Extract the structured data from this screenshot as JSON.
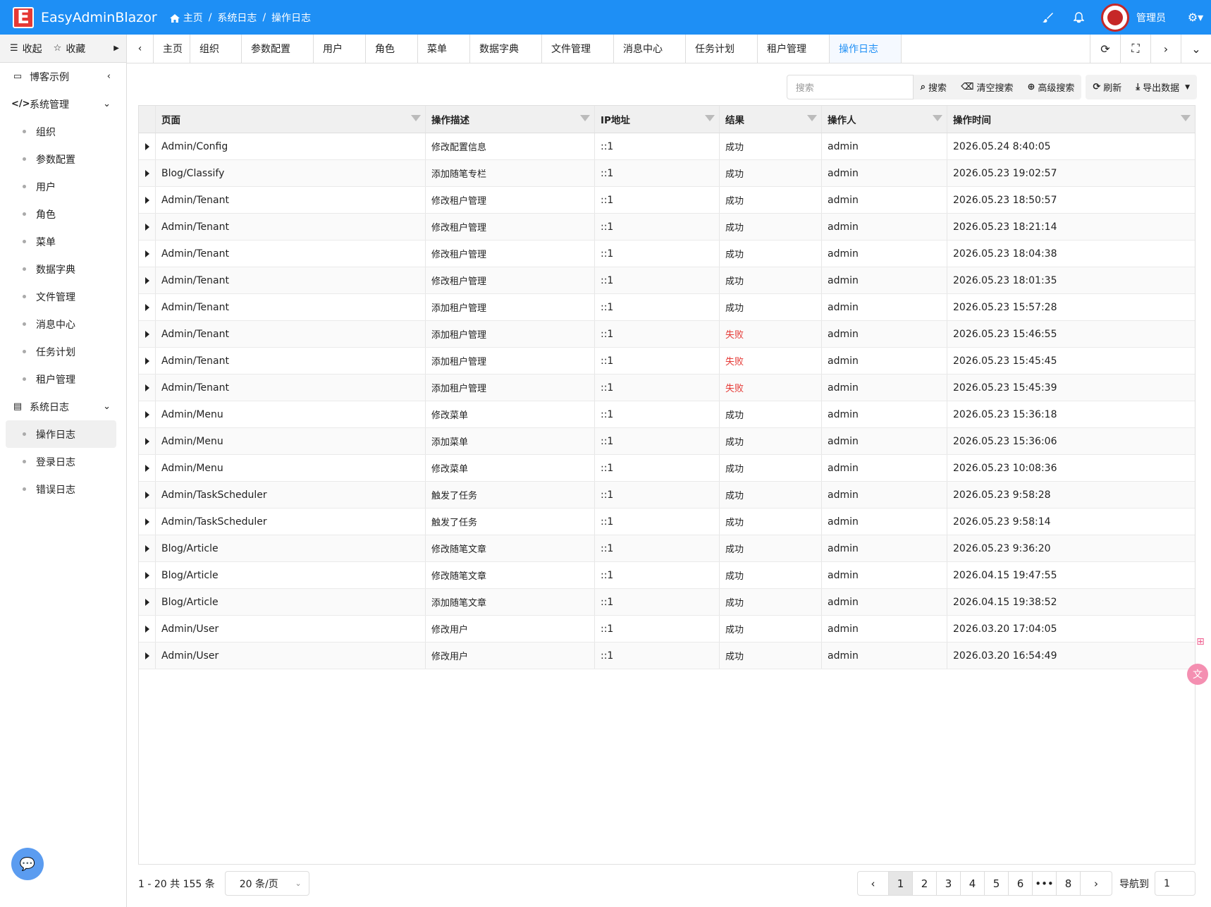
{
  "header": {
    "app_title": "EasyAdminBlazor",
    "breadcrumb": [
      "主页",
      "系统日志",
      "操作日志"
    ],
    "user_name": "管理员",
    "icons": [
      "brush-icon",
      "bell-icon",
      "gear-icon"
    ]
  },
  "sidebar": {
    "collapse_label": "收起",
    "favorites_label": "收藏",
    "groups": [
      {
        "label": "博客示例",
        "icon": "laptop-icon",
        "expanded": false,
        "items": []
      },
      {
        "label": "系统管理",
        "icon": "code-icon",
        "expanded": true,
        "items": [
          "组织",
          "参数配置",
          "用户",
          "角色",
          "菜单",
          "数据字典",
          "文件管理",
          "消息中心",
          "任务计划",
          "租户管理"
        ]
      },
      {
        "label": "系统日志",
        "icon": "server-icon",
        "expanded": true,
        "items": [
          "操作日志",
          "登录日志",
          "错误日志"
        ]
      }
    ],
    "active_item": "操作日志"
  },
  "tabs": [
    "主页",
    "组织",
    "参数配置",
    "用户",
    "角色",
    "菜单",
    "数据字典",
    "文件管理",
    "消息中心",
    "任务计划",
    "租户管理",
    "操作日志"
  ],
  "active_tab": "操作日志",
  "toolbar": {
    "search_placeholder": "搜索",
    "search_label": "搜索",
    "clear_label": "清空搜索",
    "advanced_label": "高级搜索",
    "refresh_label": "刷新",
    "export_label": "导出数据"
  },
  "table": {
    "columns": [
      "页面",
      "操作描述",
      "IP地址",
      "结果",
      "操作人",
      "操作时间"
    ],
    "rows": [
      [
        "Admin/Config",
        "修改配置信息",
        "::1",
        "成功",
        "admin",
        "2026.05.24 8:40:05"
      ],
      [
        "Blog/Classify",
        "添加随笔专栏",
        "::1",
        "成功",
        "admin",
        "2026.05.23 19:02:57"
      ],
      [
        "Admin/Tenant",
        "修改租户管理",
        "::1",
        "成功",
        "admin",
        "2026.05.23 18:50:57"
      ],
      [
        "Admin/Tenant",
        "修改租户管理",
        "::1",
        "成功",
        "admin",
        "2026.05.23 18:21:14"
      ],
      [
        "Admin/Tenant",
        "修改租户管理",
        "::1",
        "成功",
        "admin",
        "2026.05.23 18:04:38"
      ],
      [
        "Admin/Tenant",
        "修改租户管理",
        "::1",
        "成功",
        "admin",
        "2026.05.23 18:01:35"
      ],
      [
        "Admin/Tenant",
        "添加租户管理",
        "::1",
        "成功",
        "admin",
        "2026.05.23 15:57:28"
      ],
      [
        "Admin/Tenant",
        "添加租户管理",
        "::1",
        "失败",
        "admin",
        "2026.05.23 15:46:55"
      ],
      [
        "Admin/Tenant",
        "添加租户管理",
        "::1",
        "失败",
        "admin",
        "2026.05.23 15:45:45"
      ],
      [
        "Admin/Tenant",
        "添加租户管理",
        "::1",
        "失败",
        "admin",
        "2026.05.23 15:45:39"
      ],
      [
        "Admin/Menu",
        "修改菜单",
        "::1",
        "成功",
        "admin",
        "2026.05.23 15:36:18"
      ],
      [
        "Admin/Menu",
        "添加菜单",
        "::1",
        "成功",
        "admin",
        "2026.05.23 15:36:06"
      ],
      [
        "Admin/Menu",
        "修改菜单",
        "::1",
        "成功",
        "admin",
        "2026.05.23 10:08:36"
      ],
      [
        "Admin/TaskScheduler",
        "触发了任务",
        "::1",
        "成功",
        "admin",
        "2026.05.23 9:58:28"
      ],
      [
        "Admin/TaskScheduler",
        "触发了任务",
        "::1",
        "成功",
        "admin",
        "2026.05.23 9:58:14"
      ],
      [
        "Blog/Article",
        "修改随笔文章",
        "::1",
        "成功",
        "admin",
        "2026.05.23 9:36:20"
      ],
      [
        "Blog/Article",
        "修改随笔文章",
        "::1",
        "成功",
        "admin",
        "2026.04.15 19:47:55"
      ],
      [
        "Blog/Article",
        "添加随笔文章",
        "::1",
        "成功",
        "admin",
        "2026.04.15 19:38:52"
      ],
      [
        "Admin/User",
        "修改用户",
        "::1",
        "成功",
        "admin",
        "2026.03.20 17:04:05"
      ],
      [
        "Admin/User",
        "修改用户",
        "::1",
        "成功",
        "admin",
        "2026.03.20 16:54:49"
      ]
    ],
    "fail_color": "#e53935"
  },
  "pagination": {
    "range_text": "1 - 20 共 155 条",
    "page_size": "20 条/页",
    "pages": [
      "1",
      "2",
      "3",
      "4",
      "5",
      "6",
      "•••",
      "8"
    ],
    "current_page": "1",
    "goto_label": "导航到",
    "goto_value": "1"
  },
  "colors": {
    "header_bg": "#1e8ff5",
    "accent": "#1e8ff5",
    "logo": "#e53935"
  }
}
